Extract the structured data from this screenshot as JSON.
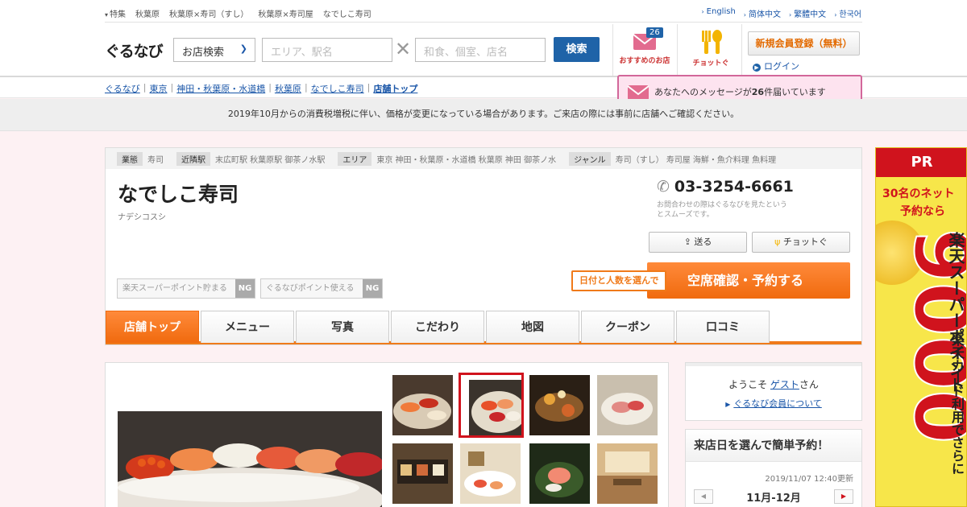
{
  "top_links": [
    "特集",
    "秋葉原",
    "秋葉原×寿司（すし）",
    "秋葉原×寿司屋",
    "なでしこ寿司"
  ],
  "languages": [
    "English",
    "简体中文",
    "繁體中文",
    "한국어"
  ],
  "header": {
    "logo": "ぐるなび",
    "search_type": "お店検索",
    "area_placeholder": "エリア、駅名",
    "keyword_placeholder": "和食、個室、店名",
    "search_label": "検索",
    "mail_badge": "26",
    "mail_label": "おすすめのお店",
    "chotto_label": "チョットぐ",
    "register_label": "新規会員登録（無料）",
    "login_label": "ログイン"
  },
  "breadcrumb": [
    "ぐるなび",
    "東京",
    "神田・秋葉原・水道橋",
    "秋葉原",
    "なでしこ寿司",
    "店舗トップ"
  ],
  "message_popup": {
    "prefix": "あなたへのメッセージが",
    "count": "26",
    "suffix": "件届いています"
  },
  "notice": "2019年10月からの消費税増税に伴い、価格が変更になっている場合があります。ご来店の際には事前に店舗へご確認ください。",
  "shop": {
    "meta": [
      {
        "key": "業態",
        "value": "寿司"
      },
      {
        "key": "近隣駅",
        "value": "末広町駅 秋葉原駅 御茶ノ水駅"
      },
      {
        "key": "エリア",
        "value": "東京 神田・秋葉原・水道橋 秋葉原 神田 御茶ノ水"
      },
      {
        "key": "ジャンル",
        "value": "寿司（すし） 寿司屋 海鮮・魚介料理 魚料理"
      }
    ],
    "name": "なでしこ寿司",
    "kana": "ナデシコスシ",
    "phone": "03-3254-6661",
    "phone_note": "お問合わせの際はぐるなびを見たというとスムーズです。",
    "send_label": "送る",
    "chotto_label": "チョットぐ",
    "rakuten_points": "楽天スーパーポイント貯まる",
    "gnavi_points": "ぐるなびポイント使える",
    "ng": "NG",
    "hint": "日付と人数を選んで",
    "reserve_label": "空席確認・予約する"
  },
  "tabs": [
    "店舗トップ",
    "メニュー",
    "写真",
    "こだわり",
    "地図",
    "クーポン",
    "口コミ"
  ],
  "sidebar": {
    "welcome_prefix": "ようこそ ",
    "guest": "ゲスト",
    "welcome_suffix": "さん",
    "member_link": "ぐるなび会員について",
    "quick_title": "来店日を選んで簡単予約！",
    "updated": "2019/11/07 12:40更新",
    "month": "11月-12月"
  },
  "banner": {
    "pr": "PR",
    "line1": "30名のネット",
    "line2": "予約なら",
    "big": "9000",
    "vertical1": "楽天スーパーポイント",
    "vertical2": "楽天カード利用でさらに"
  },
  "colors": {
    "accent": "#f07a1a",
    "link": "#1a56a8",
    "brand_red": "#d0131d",
    "pink_bg": "#fdf1f3"
  }
}
